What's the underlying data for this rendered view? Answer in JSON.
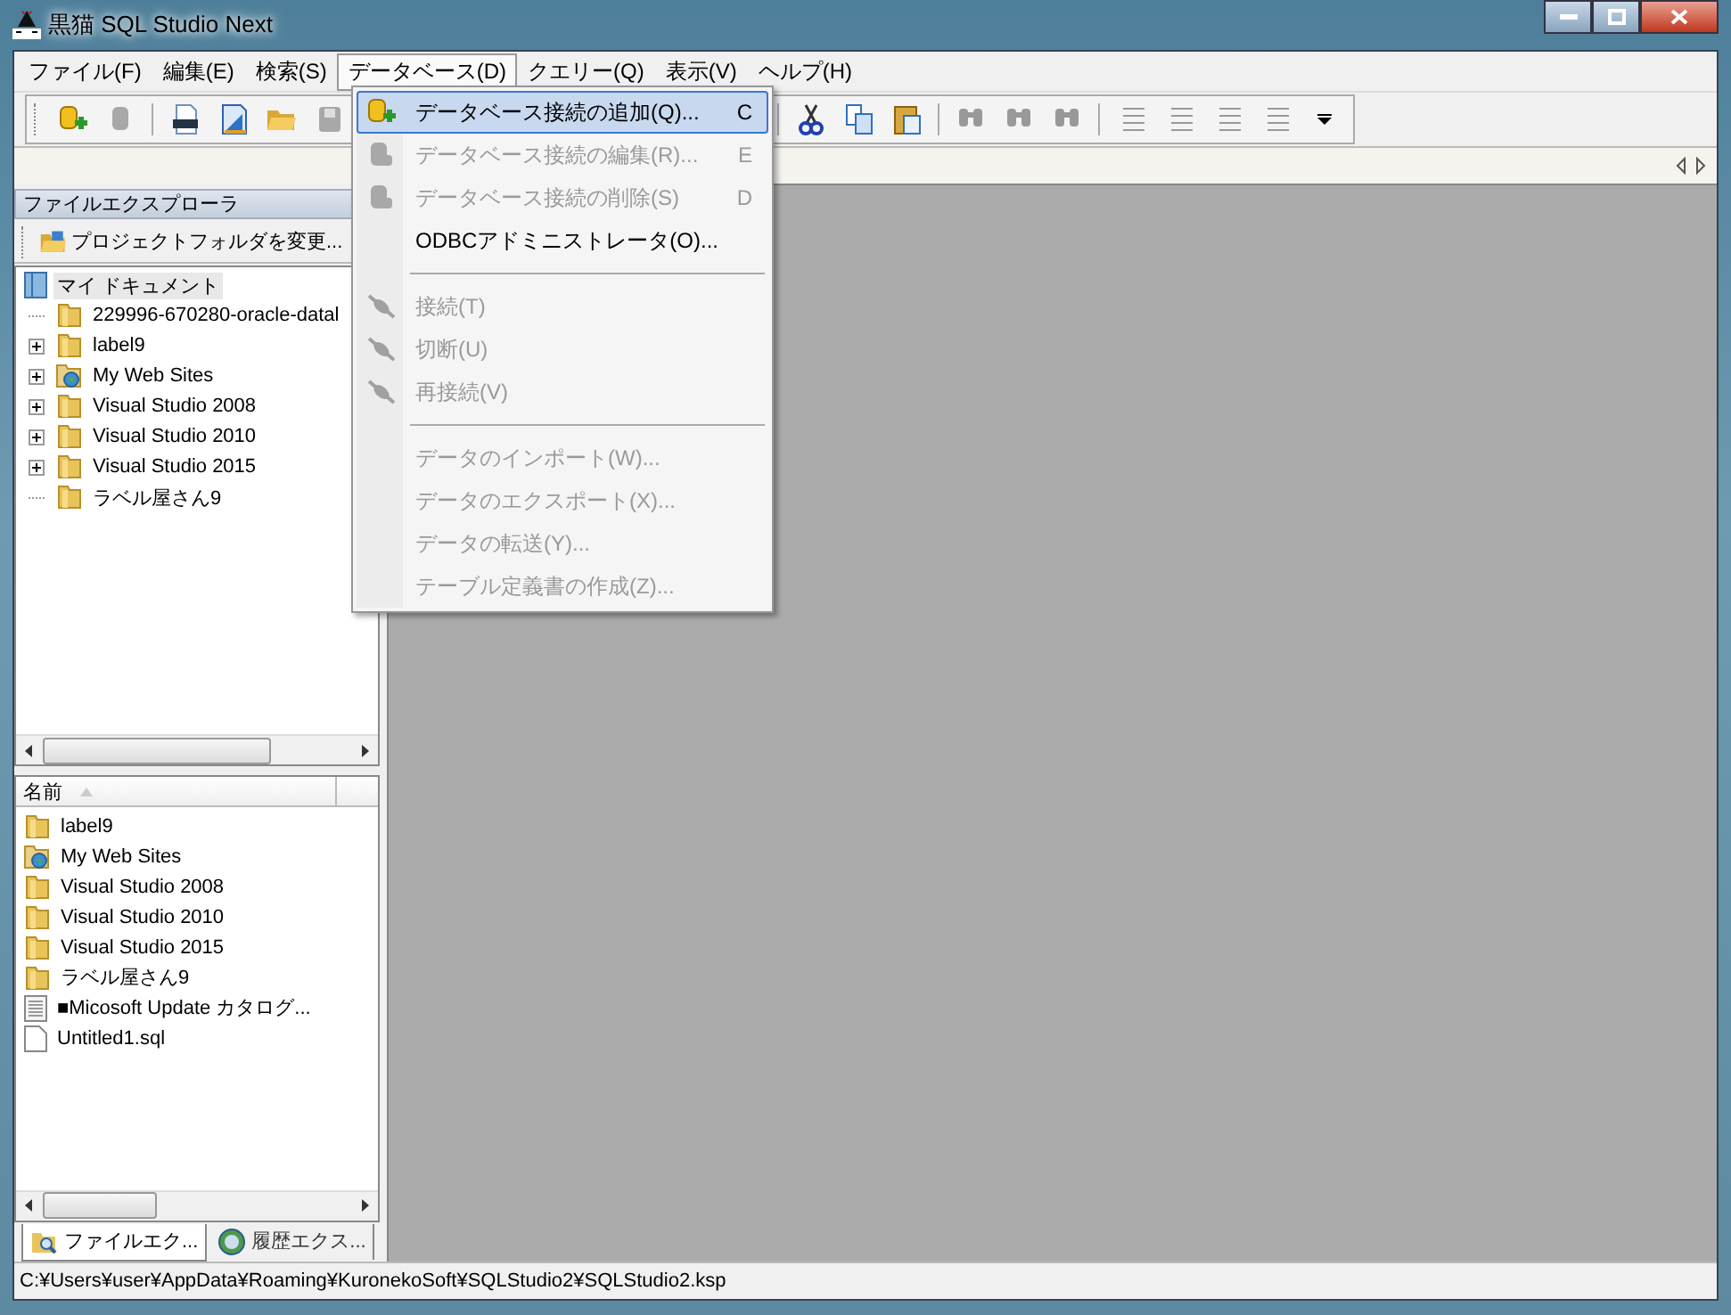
{
  "window": {
    "title": "黒猫 SQL Studio Next"
  },
  "menu_bar": [
    {
      "label": "ファイル(F)",
      "selected": false
    },
    {
      "label": "編集(E)",
      "selected": false
    },
    {
      "label": "検索(S)",
      "selected": false
    },
    {
      "label": "データベース(D)",
      "selected": true
    },
    {
      "label": "クエリー(Q)",
      "selected": false
    },
    {
      "label": "表示(V)",
      "selected": false
    },
    {
      "label": "ヘルプ(H)",
      "selected": false
    }
  ],
  "database_menu": [
    {
      "kind": "item",
      "label": "データベース接続の追加(Q)...",
      "shortcut": "C",
      "disabled": false,
      "selected": true
    },
    {
      "kind": "item",
      "label": "データベース接続の編集(R)...",
      "shortcut": "E",
      "disabled": true,
      "selected": false
    },
    {
      "kind": "item",
      "label": "データベース接続の削除(S)",
      "shortcut": "D",
      "disabled": true,
      "selected": false
    },
    {
      "kind": "item",
      "label": "ODBCアドミニストレータ(O)...",
      "disabled": false,
      "selected": false
    },
    {
      "kind": "separator"
    },
    {
      "kind": "item",
      "label": "接続(T)",
      "disabled": true,
      "selected": false
    },
    {
      "kind": "item",
      "label": "切断(U)",
      "disabled": true,
      "selected": false
    },
    {
      "kind": "item",
      "label": "再接続(V)",
      "disabled": true,
      "selected": false
    },
    {
      "kind": "separator"
    },
    {
      "kind": "item",
      "label": "データのインポート(W)...",
      "disabled": true,
      "selected": false
    },
    {
      "kind": "item",
      "label": "データのエクスポート(X)...",
      "disabled": true,
      "selected": false
    },
    {
      "kind": "item",
      "label": "データの転送(Y)...",
      "disabled": true,
      "selected": false
    },
    {
      "kind": "item",
      "label": "テーブル定義書の作成(Z)...",
      "disabled": true,
      "selected": false
    }
  ],
  "file_explorer": {
    "title": "ファイルエクスプローラ",
    "change_folder_button": "プロジェクトフォルダを変更...",
    "tree": {
      "label": "マイ ドキュメント",
      "selected": true,
      "children": [
        {
          "label": "229996-670280-oracle-datal",
          "kind": "folder",
          "expandable": false,
          "selected": false
        },
        {
          "label": "label9",
          "kind": "folder",
          "expandable": true,
          "selected": false
        },
        {
          "label": "My Web Sites",
          "kind": "web-folder",
          "expandable": true,
          "selected": false
        },
        {
          "label": "Visual Studio 2008",
          "kind": "folder",
          "expandable": true,
          "selected": false
        },
        {
          "label": "Visual Studio 2010",
          "kind": "folder",
          "expandable": true,
          "selected": false
        },
        {
          "label": "Visual Studio 2015",
          "kind": "folder",
          "expandable": true,
          "selected": false
        },
        {
          "label": "ラベル屋さん9",
          "kind": "folder",
          "expandable": false,
          "selected": false
        }
      ]
    },
    "list_column": "名前",
    "files": [
      {
        "name": "label9",
        "kind": "folder"
      },
      {
        "name": "My Web Sites",
        "kind": "web-folder"
      },
      {
        "name": "Visual Studio 2008",
        "kind": "folder"
      },
      {
        "name": "Visual Studio 2010",
        "kind": "folder"
      },
      {
        "name": "Visual Studio 2015",
        "kind": "folder"
      },
      {
        "name": "ラベル屋さん9",
        "kind": "folder"
      },
      {
        "name": "■Micosoft Update  カタログ...",
        "kind": "document"
      },
      {
        "name": "Untitled1.sql",
        "kind": "file"
      }
    ]
  },
  "panel_tabs": [
    {
      "label": "ファイルエク...",
      "selected": true
    },
    {
      "label": "履歴エクス...",
      "selected": false
    }
  ],
  "status_bar": {
    "text": "C:¥Users¥user¥AppData¥Roaming¥KuronekoSoft¥SQLStudio2¥SQLStudio2.ksp"
  }
}
